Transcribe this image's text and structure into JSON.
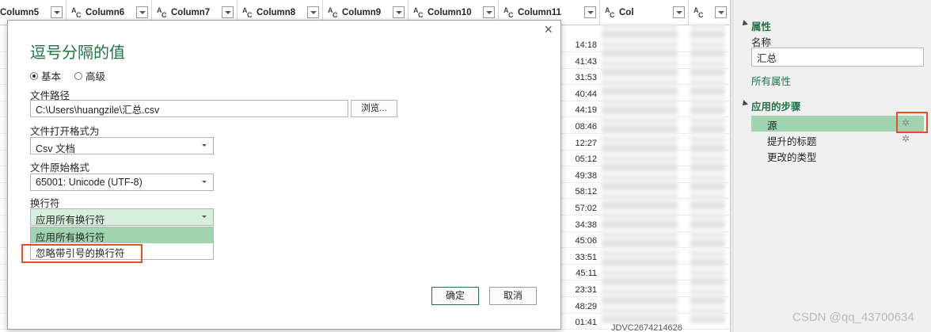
{
  "grid": {
    "columns": [
      {
        "label": "Column5"
      },
      {
        "label": "Column6"
      },
      {
        "label": "Column7"
      },
      {
        "label": "Column8"
      },
      {
        "label": "Column9"
      },
      {
        "label": "Column10"
      },
      {
        "label": "Column11"
      },
      {
        "label": "Col"
      }
    ],
    "time_values": [
      "14:18",
      "41:43",
      "31:53",
      "40:44",
      "44:19",
      "08:46",
      "12:27",
      "05:12",
      "49:38",
      "58:12",
      "57:02",
      "34:38",
      "45:06",
      "33:51",
      "45:11",
      "23:31",
      "48:29",
      "01:41"
    ],
    "bottom_row_text": "JDVC2674214626"
  },
  "dialog": {
    "title": "逗号分隔的值",
    "close_icon": "×",
    "mode_basic": "基本",
    "mode_advanced": "高级",
    "file_path_label": "文件路径",
    "file_path_value": "C:\\Users\\huangzile\\汇总.csv",
    "browse_label": "浏览...",
    "open_format_label": "文件打开格式为",
    "open_format_value": "Csv 文档",
    "origin_label": "文件原始格式",
    "origin_value": "65001: Unicode (UTF-8)",
    "line_break_label": "换行符",
    "line_break_value": "应用所有换行符",
    "line_break_options": [
      "应用所有换行符",
      "忽略带引号的换行符"
    ],
    "ok_label": "确定",
    "cancel_label": "取消"
  },
  "panel": {
    "properties_title": "属性",
    "name_label": "名称",
    "name_value": "汇总",
    "all_properties_link": "所有属性",
    "steps_title": "应用的步骤",
    "steps": [
      "源",
      "提升的标题",
      "更改的类型"
    ],
    "gear_icon": "✲"
  },
  "watermark": "CSDN @qq_43700634",
  "colors": {
    "accent": "#217346",
    "selected": "#a0d4b0",
    "highlight": "#e0502a"
  }
}
